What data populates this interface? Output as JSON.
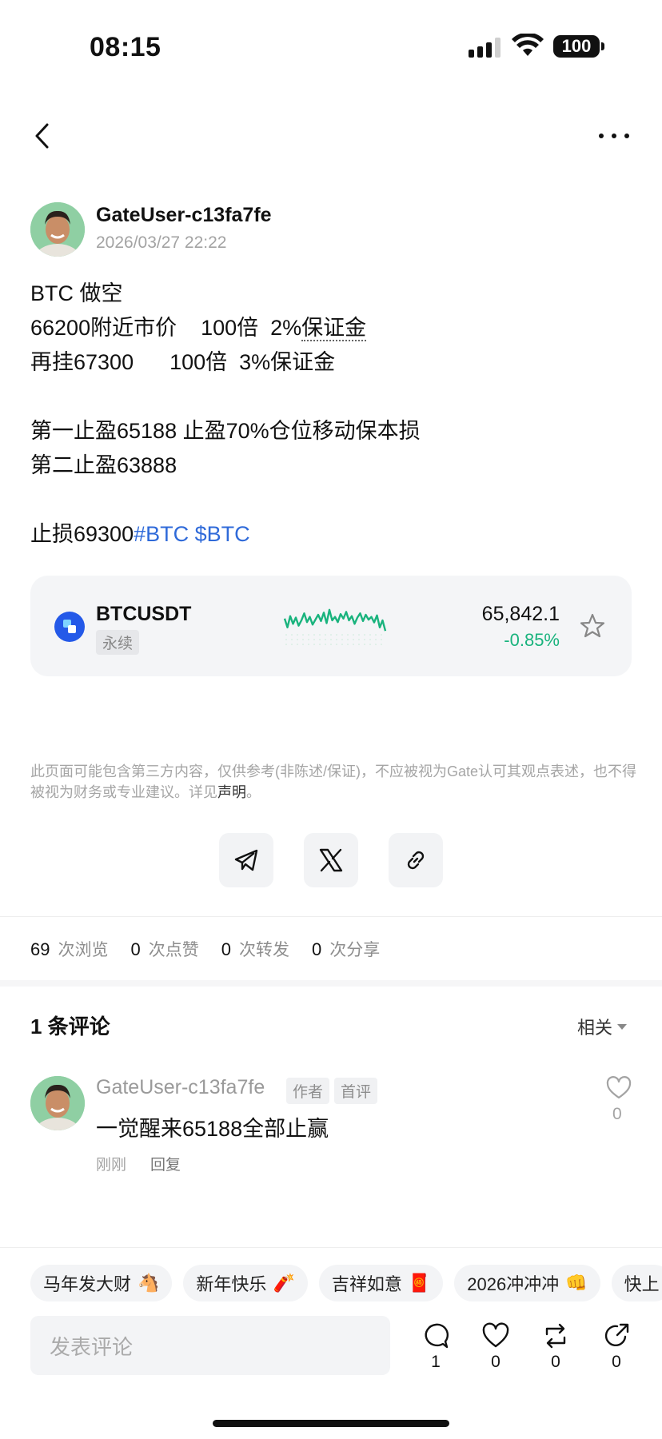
{
  "status": {
    "time": "08:15",
    "battery": "100"
  },
  "post": {
    "author": "GateUser-c13fa7fe",
    "timestamp": "2026/03/27 22:22",
    "lines": {
      "l1": "BTC 做空",
      "l2a": "66200附近市价    100倍  2%",
      "l2b": "保证金",
      "l3": "再挂67300      100倍  3%保证金",
      "l4": "第一止盈65188 止盈70%仓位移动保本损",
      "l5": "第二止盈63888",
      "l6": "止损69300",
      "tag1": "#BTC",
      "tag2": "$BTC"
    }
  },
  "ticker": {
    "symbol": "BTCUSDT",
    "kind": "永续",
    "price": "65,842.1",
    "change": "-0.85%",
    "change_color": "#19b37d",
    "sparkline": [
      0.55,
      0.3,
      0.62,
      0.4,
      0.58,
      0.35,
      0.5,
      0.7,
      0.45,
      0.6,
      0.38,
      0.52,
      0.66,
      0.48,
      0.72,
      0.42,
      0.8,
      0.5,
      0.6,
      0.45,
      0.68,
      0.55,
      0.74,
      0.5,
      0.62,
      0.4,
      0.58,
      0.7,
      0.48,
      0.66,
      0.52,
      0.6,
      0.44,
      0.64,
      0.3,
      0.5,
      0.2
    ]
  },
  "disclaimer": {
    "text": "此页面可能包含第三方内容，仅供参考(非陈述/保证)，不应被视为Gate认可其观点表述，也不得被视为财务或专业建议。详见",
    "link": "声明",
    "end": "。"
  },
  "stats": {
    "views": "69",
    "views_label": "次浏览",
    "likes": "0",
    "likes_label": "次点赞",
    "reposts": "0",
    "reposts_label": "次转发",
    "shares": "0",
    "shares_label": "次分享"
  },
  "comments": {
    "title": "1 条评论",
    "sort": "相关",
    "items": [
      {
        "author": "GateUser-c13fa7fe",
        "badge_author": "作者",
        "badge_first": "首评",
        "text": "一觉醒来65188全部止赢",
        "time": "刚刚",
        "reply": "回复",
        "likes": "0"
      }
    ]
  },
  "chips": [
    {
      "label": "马年发大财",
      "emoji": "🐴"
    },
    {
      "label": "新年快乐",
      "emoji": "🧨"
    },
    {
      "label": "吉祥如意",
      "emoji": "🧧"
    },
    {
      "label": "2026冲冲冲",
      "emoji": "👊"
    },
    {
      "label": "快上",
      "emoji": ""
    }
  ],
  "bottom": {
    "input_placeholder": "发表评论",
    "comment_count": "1",
    "like_count": "0",
    "repost_count": "0",
    "share_count": "0"
  },
  "icons": {
    "back": "chevron-left-icon",
    "more": "more-dots-icon",
    "star": "star-icon",
    "telegram": "telegram-icon",
    "x": "x-logo-icon",
    "link": "link-icon",
    "heart": "heart-icon",
    "comment": "comment-bubble-icon",
    "repost": "repost-icon",
    "share": "share-icon"
  }
}
